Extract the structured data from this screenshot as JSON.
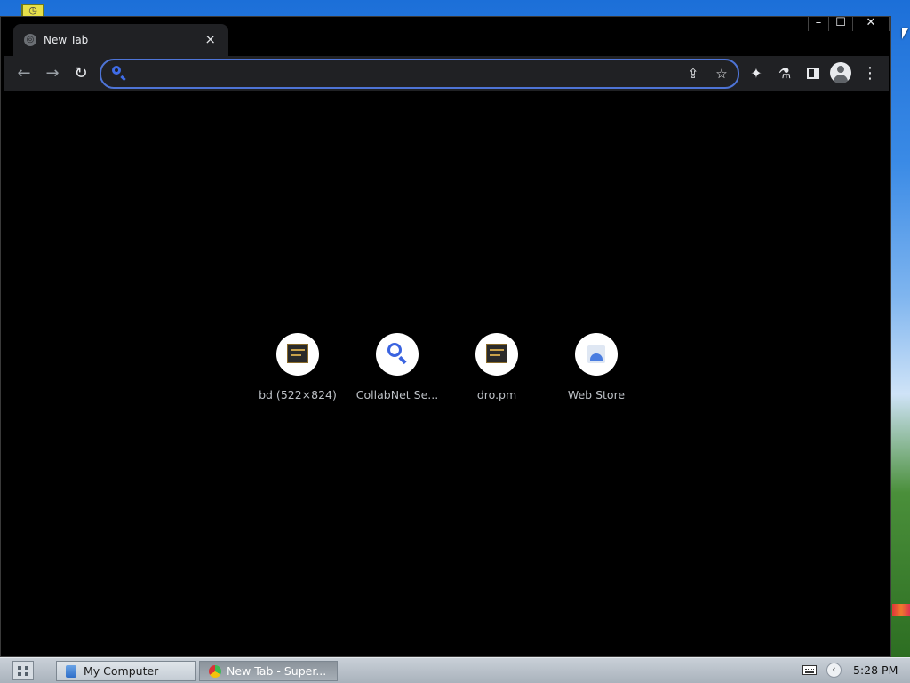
{
  "browser": {
    "tab_title": "New Tab",
    "tab_close": "×",
    "window_controls": {
      "minimize": "–",
      "maximize": "☐",
      "close": "✕"
    },
    "toolbar": {
      "back": "←",
      "forward": "→",
      "reload": "↻",
      "omnibox_value": "",
      "extensions_glyph": "✦",
      "labs_glyph": "⚗",
      "menu_glyph": "⋮",
      "share_glyph": "⇪",
      "star_glyph": "☆"
    }
  },
  "shortcuts": [
    {
      "label": "bd (522×824)",
      "icon": "thumbnail-icon"
    },
    {
      "label": "CollabNet Se...",
      "icon": "search-icon"
    },
    {
      "label": "dro.pm",
      "icon": "thumbnail-icon"
    },
    {
      "label": "Web Store",
      "icon": "web-store-icon"
    }
  ],
  "taskbar": {
    "items": [
      {
        "label": "My Computer",
        "active": false
      },
      {
        "label": "New Tab - Super...",
        "active": true
      }
    ],
    "clock": "5:28 PM",
    "tray_arrow": "‹"
  },
  "colors": {
    "accent": "#4e74d6",
    "toolbar": "#202124",
    "page_bg": "#000000"
  }
}
